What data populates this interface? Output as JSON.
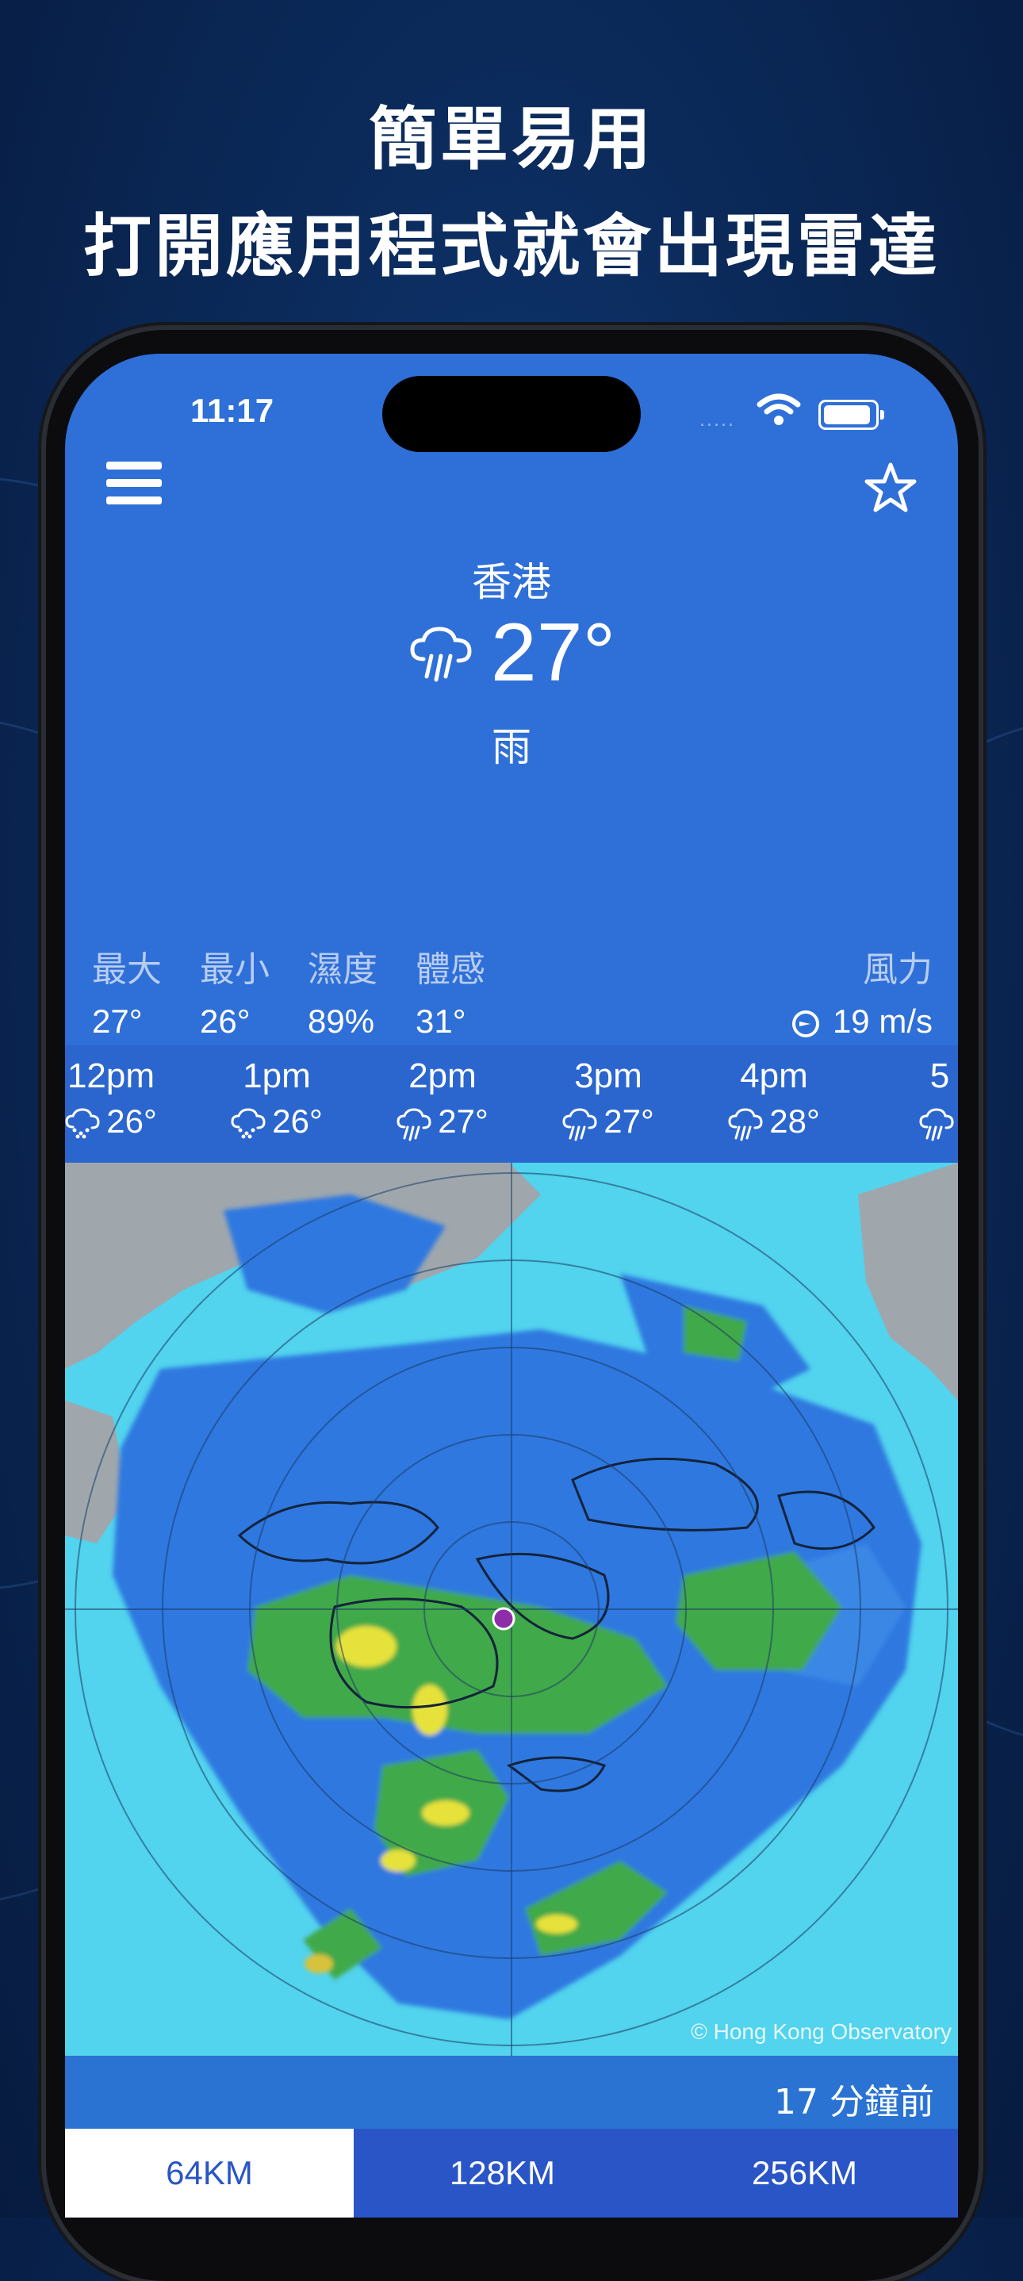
{
  "promo": {
    "line1": "簡單易用",
    "line2": "打開應用程式就會出現雷達"
  },
  "status_bar": {
    "time": "11:17",
    "signal": "....."
  },
  "header": {
    "menu_icon": "hamburger-menu-icon",
    "favorite_icon": "star-outline-icon"
  },
  "current": {
    "city": "香港",
    "temperature": "27°",
    "condition": "雨",
    "icon": "rain-cloud-icon"
  },
  "stats": {
    "max_label": "最大",
    "max_value": "27°",
    "min_label": "最小",
    "min_value": "26°",
    "humidity_label": "濕度",
    "humidity_value": "89%",
    "feels_label": "體感",
    "feels_value": "31°",
    "wind_label": "風力",
    "wind_value": "19 m/s"
  },
  "hourly": [
    {
      "time": "12pm",
      "temp": "26°",
      "icon": "drizzle-cloud-icon"
    },
    {
      "time": "1pm",
      "temp": "26°",
      "icon": "drizzle-cloud-icon"
    },
    {
      "time": "2pm",
      "temp": "27°",
      "icon": "rain-cloud-icon"
    },
    {
      "time": "3pm",
      "temp": "27°",
      "icon": "rain-cloud-icon"
    },
    {
      "time": "4pm",
      "temp": "28°",
      "icon": "rain-cloud-icon"
    },
    {
      "time": "5",
      "temp": "",
      "icon": "rain-cloud-icon"
    }
  ],
  "radar": {
    "credit": "© Hong Kong Observatory",
    "updated": "17 分鐘前"
  },
  "range_tabs": [
    {
      "label": "64KM",
      "selected": true
    },
    {
      "label": "128KM",
      "selected": false
    },
    {
      "label": "256KM",
      "selected": false
    }
  ],
  "colors": {
    "screen_bg": "#2f6fd8",
    "tab_bar": "#2a55c6",
    "sea_cyan": "#52d3ee",
    "rain_blue": "#2f78e0",
    "rain_green": "#3fa94a",
    "rain_yellow": "#e6e23a"
  }
}
